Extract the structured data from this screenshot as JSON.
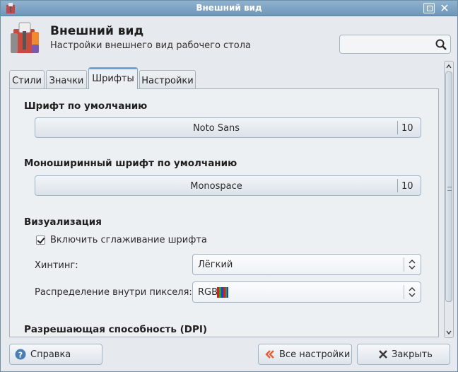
{
  "window": {
    "title": "Внешний вид",
    "header_title": "Внешний вид",
    "header_subtitle": "Настройки внешнего вид рабочего стола",
    "search_placeholder": ""
  },
  "tabs": [
    {
      "label": "Стили",
      "active": false
    },
    {
      "label": "Значки",
      "active": false
    },
    {
      "label": "Шрифты",
      "active": true
    },
    {
      "label": "Настройки",
      "active": false
    }
  ],
  "fonts": {
    "default_title": "Шрифт по умолчанию",
    "default_font": "Noto Sans",
    "default_size": "10",
    "mono_title": "Моноширинный шрифт по умолчанию",
    "mono_font": "Monospace",
    "mono_size": "10"
  },
  "rendering": {
    "title": "Визуализация",
    "antialias_label": "Включить сглаживание шрифта",
    "antialias_checked": true,
    "hinting_label": "Хинтинг:",
    "hinting_value": "Лёгкий",
    "subpixel_label": "Распределение внутри пикселя:",
    "subpixel_value": "RGB"
  },
  "dpi": {
    "title": "Разрешающая способность (DPI)"
  },
  "buttons": {
    "help": "Справка",
    "all_settings": "Все настройки",
    "close": "Закрыть"
  },
  "colors": {
    "titlebar": "#7fa5c6",
    "accent": "#6ea0cf",
    "close_icon": "#3a3a3a",
    "back_icon": "#e0623a",
    "help_icon": "#4a7fb5"
  }
}
